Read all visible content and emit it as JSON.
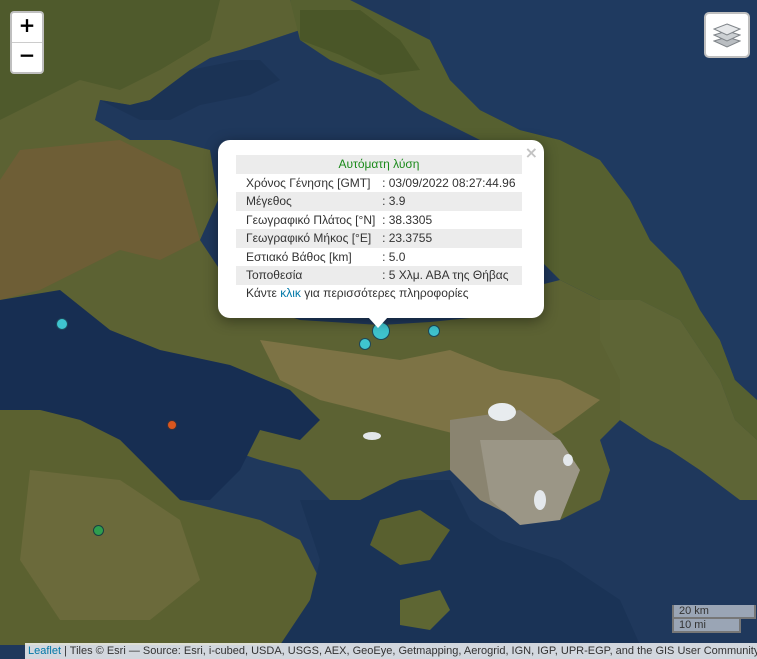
{
  "zoom": {
    "in_label": "+",
    "out_label": "−"
  },
  "layers": {
    "icon": "layers-icon"
  },
  "popup": {
    "title": "Αυτόματη λύση",
    "close": "×",
    "rows": [
      {
        "label": "Χρόνος Γένησης [GMT]",
        "value": ": 03/09/2022 08:27:44.96"
      },
      {
        "label": "Μέγεθος",
        "value": ": 3.9"
      },
      {
        "label": "Γεωγραφικό Πλάτος [°N]",
        "value": ": 38.3305"
      },
      {
        "label": "Γεωγραφικό Μήκος [°E]",
        "value": ": 23.3755"
      },
      {
        "label": "Εστιακό Βάθος [km]",
        "value": ": 5.0"
      },
      {
        "label": "Τοποθεσία",
        "value": ": 5 Χλμ. ΑΒΑ της Θήβας"
      }
    ],
    "more_prefix": "Κάντε ",
    "more_link": "κλικ",
    "more_suffix": " για περισσότερες πληροφορίες"
  },
  "scale": {
    "km": "20 km",
    "mi": "10 mi"
  },
  "attribution": {
    "leaflet": "Leaflet",
    "text": " | Tiles © Esri — Source: Esri, i-cubed, USDA, USGS, AEX, GeoEye, Getmapping, Aerogrid, IGN, IGP, UPR-EGP, and the GIS User Community"
  },
  "colors": {
    "quake_cyan": "#3fc4cf",
    "quake_orange": "#d9561e",
    "quake_green": "#2e9e4f",
    "title_green": "#1a8a1a",
    "link_blue": "#0078a8"
  }
}
